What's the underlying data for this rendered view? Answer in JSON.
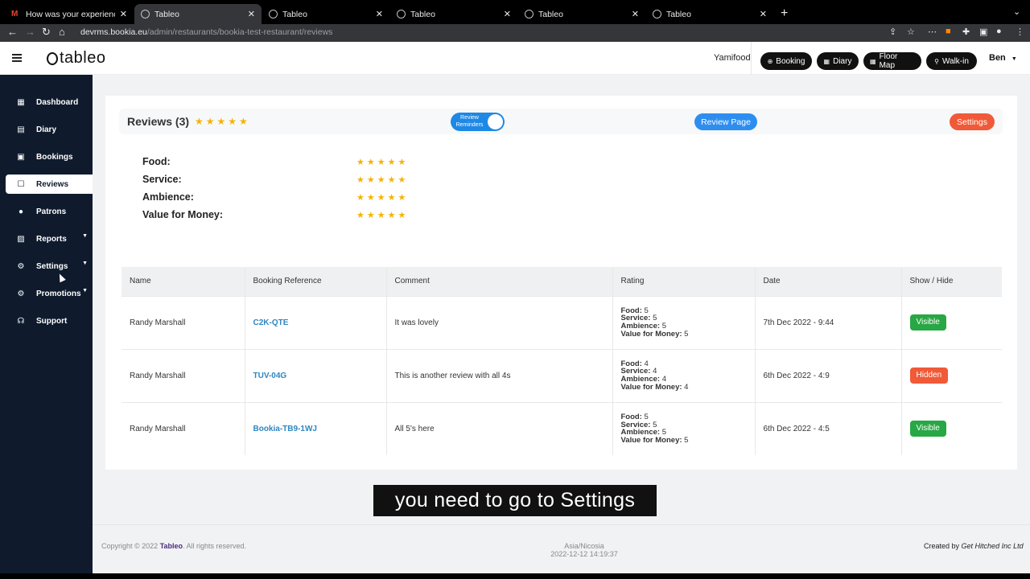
{
  "browser": {
    "tabs": [
      {
        "title": "How was your experience at Bo",
        "icon": "gmail-icon"
      },
      {
        "title": "Tableo",
        "icon": "loading-icon"
      },
      {
        "title": "Tableo",
        "icon": "loading-icon"
      },
      {
        "title": "Tableo",
        "icon": "loading-icon"
      },
      {
        "title": "Tableo",
        "icon": "loading-icon"
      },
      {
        "title": "Tableo",
        "icon": "loading-icon"
      }
    ],
    "url_domain": "devrms.bookia.eu",
    "url_path": "/admin/restaurants/bookia-test-restaurant/reviews"
  },
  "header": {
    "logo_text": "tableo",
    "restaurant": "Yamifood",
    "buttons": {
      "booking": "Booking",
      "diary": "Diary",
      "floor_map": "Floor Map",
      "walk_in": "Walk-in"
    },
    "user": "Ben"
  },
  "sidebar": {
    "items": [
      {
        "label": "Dashboard",
        "icon": "dashboard-icon"
      },
      {
        "label": "Diary",
        "icon": "calendar-icon"
      },
      {
        "label": "Bookings",
        "icon": "bookings-icon"
      },
      {
        "label": "Reviews",
        "icon": "reviews-icon",
        "active": true
      },
      {
        "label": "Patrons",
        "icon": "person-icon"
      },
      {
        "label": "Reports",
        "icon": "chart-icon"
      },
      {
        "label": "Settings",
        "icon": "gear-icon"
      },
      {
        "label": "Promotions",
        "icon": "gear-icon"
      },
      {
        "label": "Support",
        "icon": "headset-icon"
      }
    ]
  },
  "reviews": {
    "title": "Reviews (3)",
    "overall_stars": 5,
    "toggle_label": "Review Reminders",
    "toggle_on": true,
    "review_page_button": "Review Page",
    "settings_button": "Settings",
    "categories": [
      {
        "label": "Food:",
        "stars": 5
      },
      {
        "label": "Service:",
        "stars": 5
      },
      {
        "label": "Ambience:",
        "stars": 5
      },
      {
        "label": "Value for Money:",
        "stars": 5
      }
    ],
    "table": {
      "headers": [
        "Name",
        "Booking Reference",
        "Comment",
        "Rating",
        "Date",
        "Show / Hide"
      ],
      "rating_labels": {
        "food": "Food:",
        "service": "Service:",
        "ambience": "Ambience:",
        "value": "Value for Money:"
      },
      "rows": [
        {
          "name": "Randy Marshall",
          "ref": "C2K-QTE",
          "comment": "It was lovely",
          "food": "5",
          "service": "5",
          "ambience": "5",
          "value": "5",
          "date": "7th Dec 2022 - 9:44",
          "status": "Visible"
        },
        {
          "name": "Randy Marshall",
          "ref": "TUV-04G",
          "comment": "This is another review with all 4s",
          "food": "4",
          "service": "4",
          "ambience": "4",
          "value": "4",
          "date": "6th Dec 2022 - 4:9",
          "status": "Hidden"
        },
        {
          "name": "Randy Marshall",
          "ref": "Bookia-TB9-1WJ",
          "comment": "All 5's here",
          "food": "5",
          "service": "5",
          "ambience": "5",
          "value": "5",
          "date": "6th Dec 2022 - 4:5",
          "status": "Visible"
        }
      ]
    }
  },
  "caption": "you need to go to Settings",
  "footer": {
    "copyright_prefix": "Copyright © 2022",
    "brand": "Tableo",
    "copyright_suffix": ". All rights reserved.",
    "timezone": "Asia/Nicosia",
    "datetime": "2022-12-12 14:19:37",
    "created_by_prefix": "Created by",
    "company": "Get Hitched Inc Ltd"
  },
  "colors": {
    "sidebar_bg": "#0f1b2d",
    "star": "#f5b301",
    "primary_blue": "#2e8ef0",
    "danger_orange": "#f05a38",
    "success_green": "#28a745"
  }
}
